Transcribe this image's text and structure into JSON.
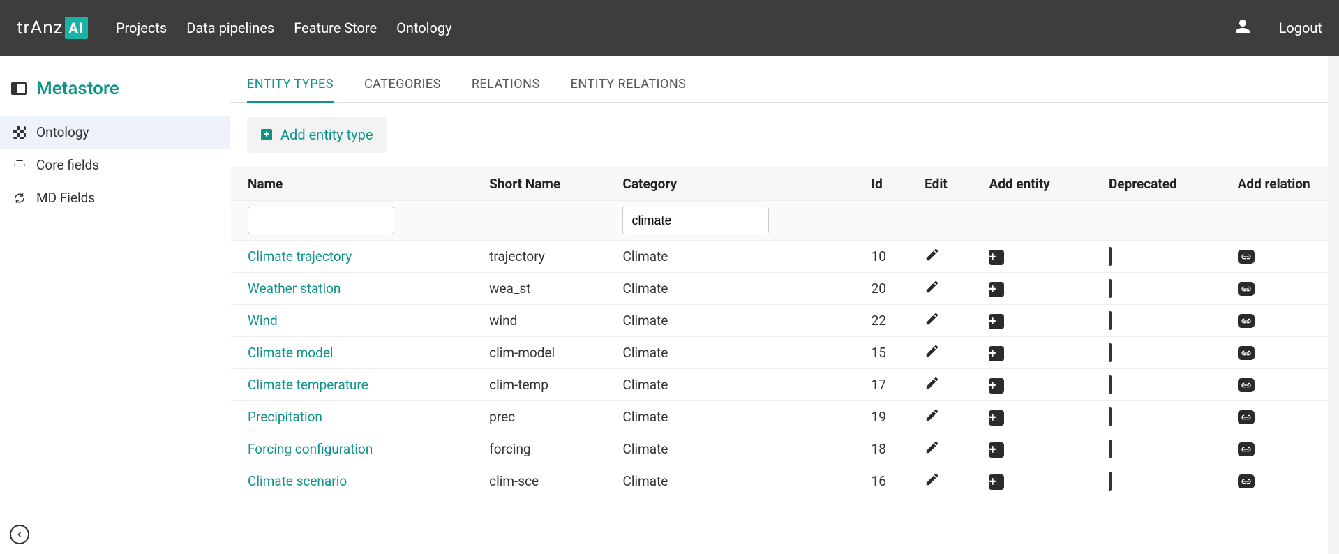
{
  "brand": {
    "name": "trAnz",
    "badge": "AI"
  },
  "nav": {
    "links": [
      "Projects",
      "Data pipelines",
      "Feature Store",
      "Ontology"
    ],
    "logout": "Logout"
  },
  "sidebar": {
    "title": "Metastore",
    "items": [
      {
        "label": "Ontology",
        "icon": "checker",
        "active": true
      },
      {
        "label": "Core fields",
        "icon": "hexagon",
        "active": false
      },
      {
        "label": "MD Fields",
        "icon": "refresh",
        "active": false
      }
    ]
  },
  "tabs": [
    {
      "label": "ENTITY TYPES",
      "active": true
    },
    {
      "label": "CATEGORIES",
      "active": false
    },
    {
      "label": "RELATIONS",
      "active": false
    },
    {
      "label": "ENTITY RELATIONS",
      "active": false
    }
  ],
  "add_button": "Add entity type",
  "columns": {
    "name": "Name",
    "short": "Short Name",
    "category": "Category",
    "id": "Id",
    "edit": "Edit",
    "add": "Add entity",
    "deprecated": "Deprecated",
    "relation": "Add relation"
  },
  "filters": {
    "name": "",
    "category": "climate"
  },
  "rows": [
    {
      "name": "Climate trajectory",
      "short": "trajectory",
      "category": "Climate",
      "id": "10"
    },
    {
      "name": "Weather station",
      "short": "wea_st",
      "category": "Climate",
      "id": "20"
    },
    {
      "name": "Wind",
      "short": "wind",
      "category": "Climate",
      "id": "22"
    },
    {
      "name": "Climate model",
      "short": "clim-model",
      "category": "Climate",
      "id": "15"
    },
    {
      "name": "Climate temperature",
      "short": "clim-temp",
      "category": "Climate",
      "id": "17"
    },
    {
      "name": "Precipitation",
      "short": "prec",
      "category": "Climate",
      "id": "19"
    },
    {
      "name": "Forcing configuration",
      "short": "forcing",
      "category": "Climate",
      "id": "18"
    },
    {
      "name": "Climate scenario",
      "short": "clim-sce",
      "category": "Climate",
      "id": "16"
    }
  ]
}
